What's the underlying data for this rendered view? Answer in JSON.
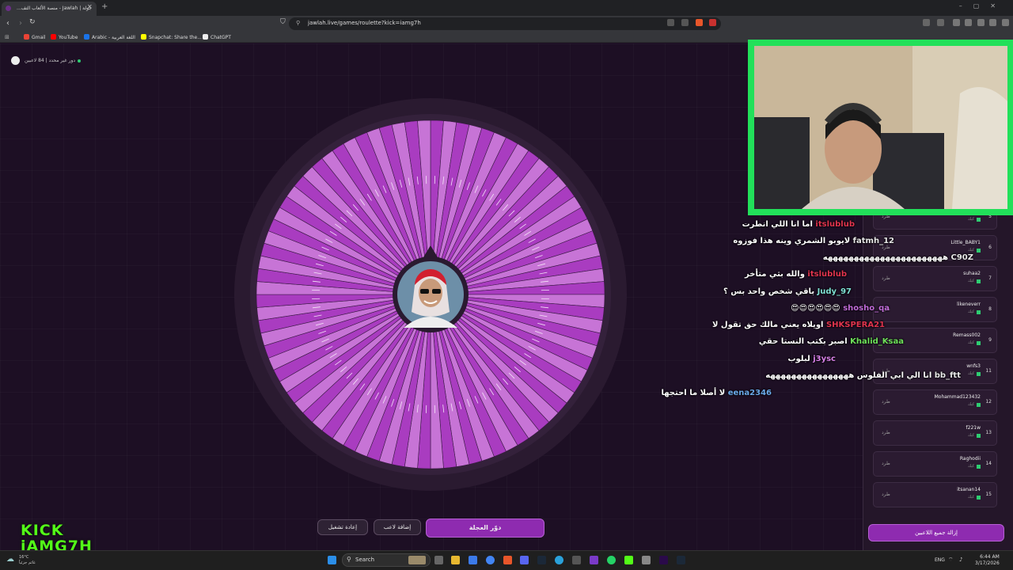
{
  "browser": {
    "tab_title": "جولة | Jawlah - منصة الألعاب التف...",
    "url": "jawlah.live/games/roulette?kick=iamg7h",
    "bookmarks": [
      {
        "label": "Gmail",
        "color": "#ea4335"
      },
      {
        "label": "YouTube",
        "color": "#ff0000"
      },
      {
        "label": "Arabic - اللغة العربية",
        "color": "#1a73e8"
      },
      {
        "label": "Snapchat: Share the...",
        "color": "#fffc00"
      },
      {
        "label": "ChatGPT",
        "color": "#eeeeee"
      }
    ]
  },
  "header": {
    "status_text": "دور غير محدد | 84 لاعبين"
  },
  "wheel": {
    "segment_count": 84,
    "colors": [
      "#a93cc0",
      "#c774d6"
    ],
    "rim_color": "#2f1d36"
  },
  "buttons": {
    "reset": "إعادة تشغيل",
    "add_player": "إضافة لاعب",
    "spin": "دوّر العجلة",
    "remove_all": "إزالة جميع اللاعبين"
  },
  "players": {
    "kick_label": "طرد",
    "sub_label": "كيك",
    "list": [
      {
        "num": "5",
        "name": "...jaay"
      },
      {
        "num": "6",
        "name": "Little_BABY1"
      },
      {
        "num": "7",
        "name": "suhaa2"
      },
      {
        "num": "8",
        "name": "likeneverr"
      },
      {
        "num": "9",
        "name": "Remass002"
      },
      {
        "num": "11",
        "name": "wnfs3"
      },
      {
        "num": "12",
        "name": "Mohammad123432"
      },
      {
        "num": "13",
        "name": "f221w"
      },
      {
        "num": "14",
        "name": "Raghodii"
      },
      {
        "num": "15",
        "name": "itsanan14"
      }
    ]
  },
  "chat": [
    {
      "user": "itslublub",
      "color": "#e0344e",
      "msg": "اما انا اللي انطرت"
    },
    {
      "user": "fatmh_12",
      "color": "#e8e8e8",
      "msg": "لايوبو الشمري وينه هذا فوزوه"
    },
    {
      "user": "C90Z",
      "color": "#e8e8e8",
      "msg": "هههههههههههههههههههههههه"
    },
    {
      "user": "itslublub",
      "color": "#e0344e",
      "msg": "والله بثي متأخر"
    },
    {
      "user": "Judy_97",
      "color": "#7fe0d4",
      "msg": "باقي شخص واحد بس ؟"
    },
    {
      "user": "shosho_qa",
      "color": "#c06bd8",
      "msg": "😍😍😍😍😍😍"
    },
    {
      "user": "SHKSPERA21",
      "color": "#e0344e",
      "msg": "اويلاه يعني مالك حق تقول لا"
    },
    {
      "user": "Khalid_Ksaa",
      "color": "#6ee05a",
      "msg": "اصبر بكتب النستا حقي"
    },
    {
      "user": "j3ysc",
      "color": "#d880e8",
      "msg": "لبلوب"
    },
    {
      "user": "bb_ftt",
      "color": "#e8e8e8",
      "msg": "انا الي ابي الفلوس ههههههههههههههههه"
    },
    {
      "user": "eena2346",
      "color": "#6aa8e8",
      "msg": "لا أصلا ما احتجها"
    }
  ],
  "overlay": {
    "kick_brand_line1": "KICK",
    "kick_brand_line2": "iAMG7H"
  },
  "taskbar": {
    "search": "Search",
    "weather_temp": "16°C",
    "weather_desc": "غائم جزئياً",
    "lang": "ENG",
    "time": "6:44 AM",
    "date": "3/17/2026"
  }
}
